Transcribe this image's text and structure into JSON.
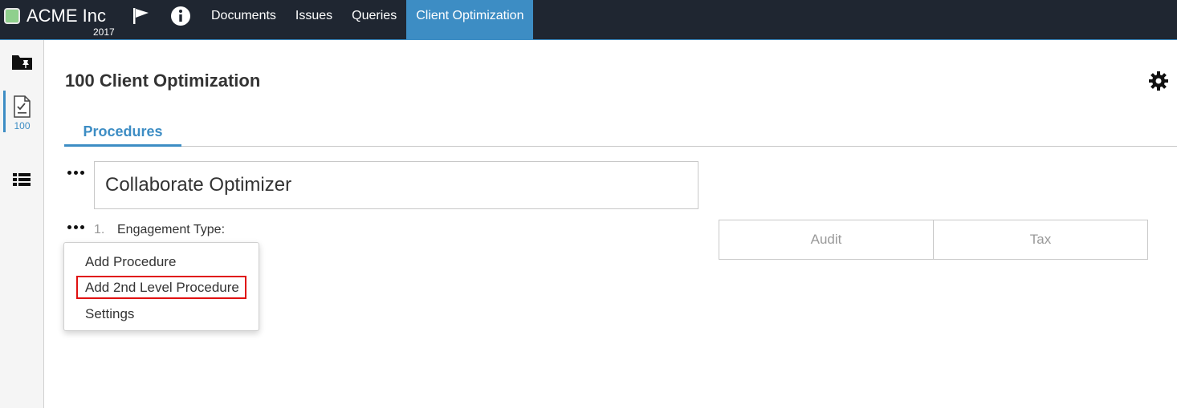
{
  "topbar": {
    "company": "ACME Inc",
    "year": "2017",
    "flag_icon": "flag-icon",
    "info_icon": "info-icon",
    "nav": [
      "Documents",
      "Issues",
      "Queries",
      "Client Optimization"
    ],
    "active_nav": "Client Optimization",
    "brand_color": "#8fd08d",
    "bar_color": "#1f2631",
    "accent_color": "#3d8dc4"
  },
  "rail": {
    "items": [
      "folder-pin-icon",
      "checklist-document-icon",
      "list-icon"
    ],
    "active_number": "100"
  },
  "page": {
    "title": "100 Client Optimization",
    "settings_icon": "gear-icon",
    "tabs": [
      "Procedures"
    ]
  },
  "content": {
    "section_title": "Collaborate Optimizer",
    "procedure_number": "1.",
    "procedure_label": "Engagement Type:",
    "options": [
      "Audit",
      "Tax"
    ]
  },
  "context_menu": {
    "items": [
      "Add Procedure",
      "Add 2nd Level Procedure",
      "Settings"
    ],
    "highlighted": "Add 2nd Level Procedure",
    "highlight_color": "#e01010"
  }
}
